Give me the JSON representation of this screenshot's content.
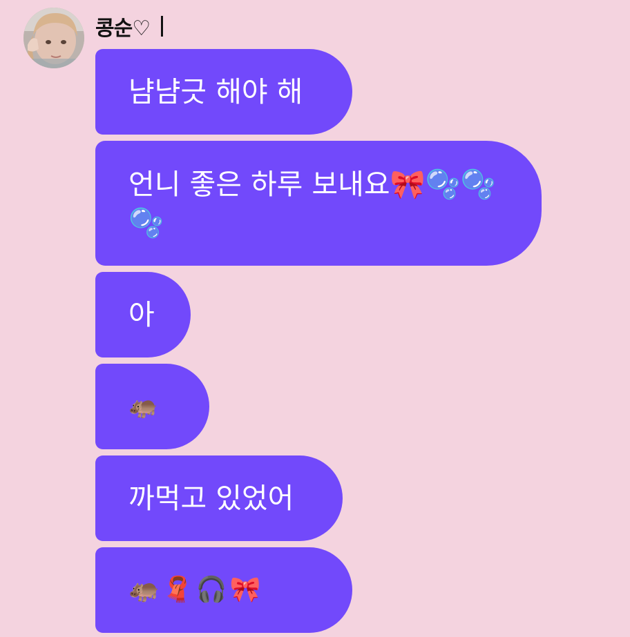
{
  "chat": {
    "sender_name": "콩순♡",
    "messages": [
      {
        "text": "냠냠긋 해야 해"
      },
      {
        "text": "언니 좋은 하루 보내요🎀🫧🫧🫧"
      },
      {
        "text": "아"
      },
      {
        "text": "🦛"
      },
      {
        "text": "까먹고 있었어"
      },
      {
        "text": "🦛🧣🎧🎀"
      }
    ]
  },
  "colors": {
    "background": "#f4d3df",
    "bubble": "#7249fb",
    "bubble_text": "#ffffff"
  }
}
